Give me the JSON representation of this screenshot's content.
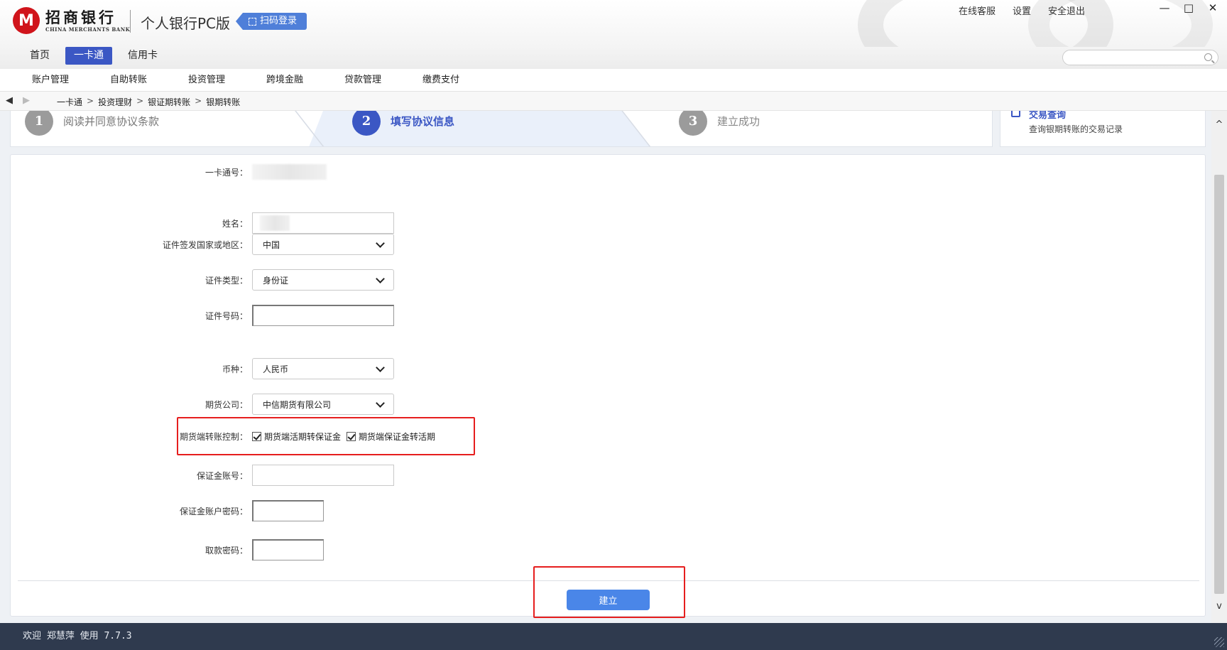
{
  "window": {
    "logo_mark": "M",
    "brand_cn": "招商银行",
    "brand_en": "CHINA MERCHANTS BANK",
    "app_title": "个人银行PC版",
    "scan_login": "扫码登录",
    "top_links": [
      "在线客服",
      "设置",
      "安全退出"
    ],
    "controls": {
      "minimize": "—",
      "maximize": "□",
      "close": "✕"
    }
  },
  "topnav": {
    "tabs": [
      {
        "label": "首页",
        "active": false
      },
      {
        "label": "一卡通",
        "active": true
      },
      {
        "label": "信用卡",
        "active": false
      }
    ],
    "search_placeholder": ""
  },
  "subnav": {
    "items": [
      "账户管理",
      "自助转账",
      "投资管理",
      "跨境金融",
      "贷款管理",
      "缴费支付"
    ]
  },
  "breadcrumb": {
    "back": "◀",
    "forward": "▶",
    "items": [
      "一卡通",
      "投资理财",
      "银证期转账",
      "银期转账"
    ],
    "separator": ">"
  },
  "steps": [
    {
      "num": "1",
      "label": "阅读并同意协议条款",
      "state": "done"
    },
    {
      "num": "2",
      "label": "填写协议信息",
      "state": "current"
    },
    {
      "num": "3",
      "label": "建立成功",
      "state": "future"
    }
  ],
  "side_card": {
    "title": "交易查询",
    "desc": "查询银期转账的交易记录"
  },
  "scrollbar": {
    "up": "^",
    "down": "v"
  },
  "form": {
    "card_no": {
      "label": "一卡通号："
    },
    "name": {
      "label": "姓名："
    },
    "issue_country": {
      "label": "证件签发国家或地区：",
      "value": "中国"
    },
    "id_type": {
      "label": "证件类型：",
      "value": "身份证"
    },
    "id_no": {
      "label": "证件号码：",
      "value": ""
    },
    "currency": {
      "label": "币种：",
      "value": "人民币"
    },
    "futures_company": {
      "label": "期货公司：",
      "value": "中信期货有限公司"
    },
    "transfer_control": {
      "label": "期货端转账控制：",
      "options": [
        {
          "label": "期货端活期转保证金",
          "checked": true
        },
        {
          "label": "期货端保证金转活期",
          "checked": true
        }
      ]
    },
    "margin_account": {
      "label": "保证金账号：",
      "value": ""
    },
    "margin_password": {
      "label": "保证金账户密码："
    },
    "withdraw_password": {
      "label": "取款密码："
    },
    "submit_label": "建立"
  },
  "status": {
    "text": "欢迎 郑慧萍 使用 7.7.3"
  },
  "colors": {
    "accent": "#3b57c4",
    "brand_red": "#d0141b",
    "highlight_red": "#e61e1e",
    "button_blue": "#4a86e8",
    "statusbar": "#2f3a4e"
  }
}
